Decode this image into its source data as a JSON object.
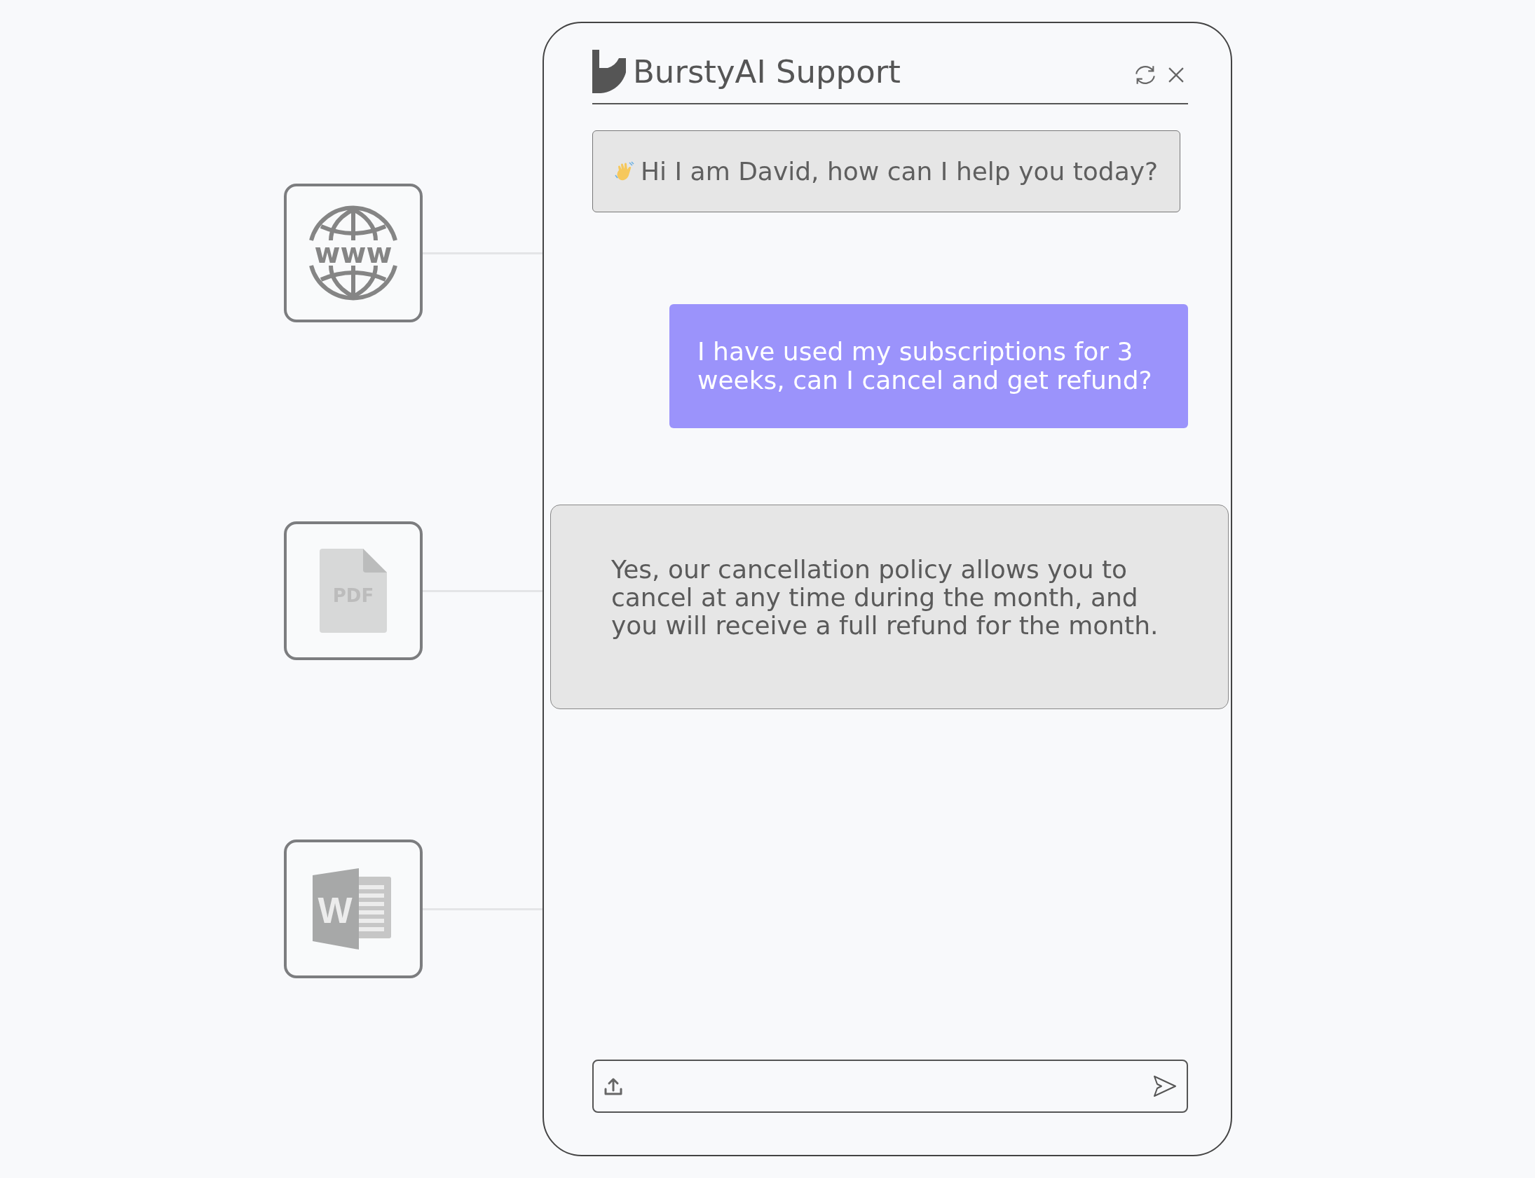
{
  "chat": {
    "title": "BurstyAI Support"
  },
  "sources": [
    {
      "kind": "web",
      "label": "www"
    },
    {
      "kind": "pdf",
      "label": "PDF"
    },
    {
      "kind": "word",
      "label": "W"
    }
  ],
  "messages": [
    {
      "kind": "bot",
      "text": "Hi I am David, how can I help you today?"
    },
    {
      "kind": "user",
      "text": "I have used my subscriptions for 3 weeks, can I cancel and get refund?"
    },
    {
      "kind": "answer",
      "text": "Yes, our cancellation policy allows you to cancel at any time during the month, and you will receive a full refund for the month."
    }
  ]
}
